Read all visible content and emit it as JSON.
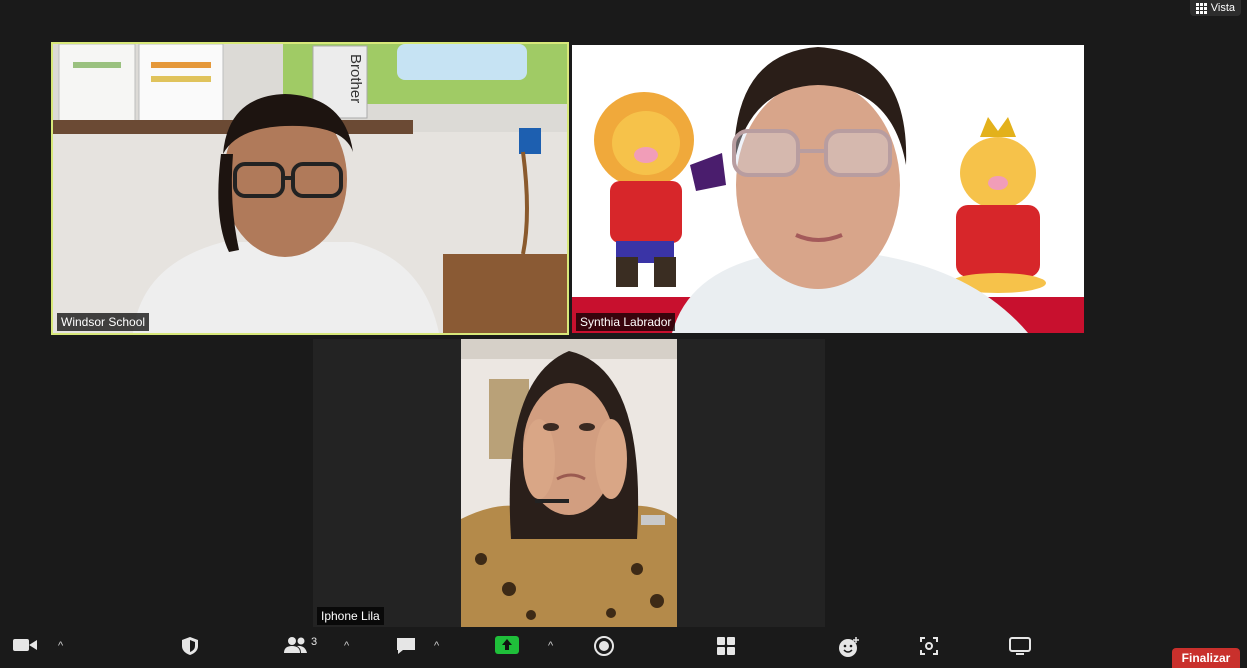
{
  "view_button": {
    "label": "Vista",
    "icon": "grid-icon"
  },
  "participants": [
    {
      "name": "Windsor School",
      "active_speaker": true,
      "highlight_color": "#d8e87a"
    },
    {
      "name": "Synthia Labrador",
      "active_speaker": false
    },
    {
      "name": "Iphone Lila",
      "active_speaker": false
    }
  ],
  "backdrop": {
    "sticky_note": "Brother"
  },
  "toolbar": {
    "participants_count": "3",
    "end_label": "Finalizar",
    "end_color": "#c9302c",
    "share_color": "#1fbf3a",
    "icons": {
      "video": "video-camera-icon",
      "security": "shield-icon",
      "participants": "people-icon",
      "chat": "chat-bubble-icon",
      "share": "share-screen-icon",
      "record": "record-icon",
      "apps": "apps-grid-icon",
      "reactions": "smiley-icon",
      "whiteboard": "whiteboard-icon",
      "more": "monitor-icon"
    }
  }
}
